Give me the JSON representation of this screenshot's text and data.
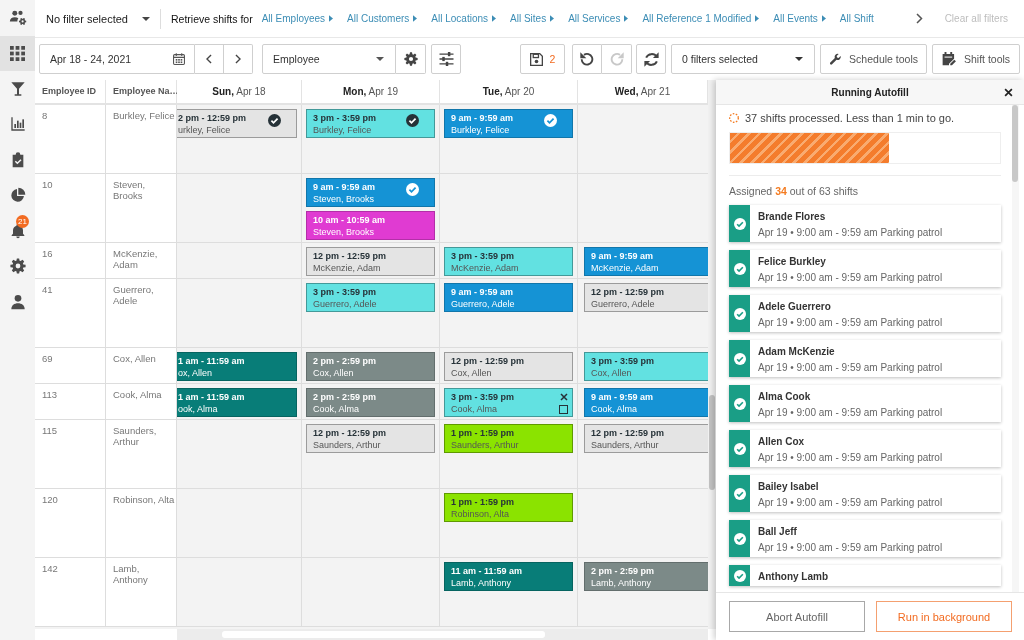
{
  "sidebar": {
    "items": [
      {
        "kind": "team",
        "selected": false
      },
      {
        "kind": "schedule",
        "selected": true
      },
      {
        "kind": "filters",
        "selected": false
      },
      {
        "kind": "reports",
        "selected": false
      },
      {
        "kind": "tasks",
        "selected": false
      },
      {
        "kind": "analytics",
        "selected": false
      },
      {
        "kind": "notifications",
        "selected": false,
        "badge": "21"
      },
      {
        "kind": "settings",
        "selected": false
      },
      {
        "kind": "profile",
        "selected": false
      }
    ]
  },
  "filter_bar": {
    "saved_filter": "No filter selected",
    "retrieve_label": "Retrieve shifts for",
    "filters": [
      {
        "label": "All Employees",
        "truncated": false
      },
      {
        "label": "All Customers",
        "truncated": false
      },
      {
        "label": "All Locations",
        "truncated": false
      },
      {
        "label": "All Sites",
        "truncated": false
      },
      {
        "label": "All Services",
        "truncated": false
      },
      {
        "label": "All Reference 1 Modified",
        "truncated": false
      },
      {
        "label": "All Events",
        "truncated": false
      },
      {
        "label": "All Shift",
        "truncated": true
      }
    ],
    "clear_all": {
      "label": "Clear all filters",
      "disabled": true
    }
  },
  "toolbar": {
    "date_range": "Apr 18 - 24, 2021",
    "group_by": "Employee",
    "unsaved_changes": "2",
    "undo": {
      "disabled": false
    },
    "redo": {
      "disabled": true
    },
    "filters_select": "0 filters selected",
    "tools": [
      {
        "kind": "schedule",
        "label": "Schedule tools"
      },
      {
        "kind": "shift",
        "label": "Shift tools"
      }
    ]
  },
  "grid": {
    "columns": [
      {
        "label": "Employee ID"
      },
      {
        "label": "Employee Na…"
      }
    ],
    "days": [
      {
        "label": "**Sun,** Apr 18"
      },
      {
        "label": "**Mon,** Apr 19"
      },
      {
        "label": "**Tue,** Apr 20"
      },
      {
        "label": "**Wed,** Apr 21"
      }
    ],
    "rows": [
      {
        "id": "8",
        "name": "Burkley, Felice",
        "expanded": true,
        "cells": [
          {
            "shifts": [
              {
                "time": "2 pm - 12:59 pm",
                "employee": "urkley, Felice",
                "color": "#e4e4e4",
                "confirmed": true,
                "hovered": false
              }
            ]
          },
          {
            "shifts": [
              {
                "time": "3 pm - 3:59 pm",
                "employee": "Burkley, Felice",
                "color": "#62e1e1",
                "confirmed": true,
                "hovered": false
              }
            ]
          },
          {
            "shifts": [
              {
                "time": "9 am - 9:59 am",
                "employee": "Burkley, Felice",
                "color": "#1593d5",
                "confirmed": true,
                "hovered": false
              }
            ]
          },
          {}
        ]
      },
      {
        "id": "10",
        "name": "Steven, Brooks",
        "expanded": true,
        "cells": [
          {},
          {
            "shifts": [
              {
                "time": "9 am - 9:59 am",
                "employee": "Steven, Brooks",
                "color": "#1593d5",
                "confirmed": true,
                "hovered": false
              },
              {
                "time": "10 am - 10:59 am",
                "employee": "Steven, Brooks",
                "color": "#e03bd2",
                "confirmed": false,
                "hovered": false
              }
            ]
          },
          {},
          {}
        ]
      },
      {
        "id": "16",
        "name": "McKenzie, Adam",
        "expanded": false,
        "cells": [
          {},
          {
            "shifts": [
              {
                "time": "12 pm - 12:59 pm",
                "employee": "McKenzie, Adam",
                "color": "#e4e4e4",
                "confirmed": false,
                "hovered": false
              }
            ]
          },
          {
            "shifts": [
              {
                "time": "3 pm - 3:59 pm",
                "employee": "McKenzie, Adam",
                "color": "#62e1e1",
                "confirmed": false,
                "hovered": false
              }
            ]
          },
          {
            "shifts": [
              {
                "time": "9 am - 9:59 am",
                "employee": "McKenzie, Adam",
                "color": "#1593d5",
                "confirmed": false,
                "hovered": false
              }
            ]
          }
        ]
      },
      {
        "id": "41",
        "name": "Guerrero, Adele",
        "expanded": true,
        "cells": [
          {},
          {
            "shifts": [
              {
                "time": "3 pm - 3:59 pm",
                "employee": "Guerrero, Adele",
                "color": "#62e1e1",
                "confirmed": false,
                "hovered": false
              }
            ]
          },
          {
            "shifts": [
              {
                "time": "9 am - 9:59 am",
                "employee": "Guerrero, Adele",
                "color": "#1593d5",
                "confirmed": false,
                "hovered": false
              }
            ]
          },
          {
            "shifts": [
              {
                "time": "12 pm - 12:59 pm",
                "employee": "Guerrero, Adele",
                "color": "#e4e4e4",
                "confirmed": false,
                "hovered": false
              }
            ]
          }
        ]
      },
      {
        "id": "69",
        "name": "Cox, Allen",
        "expanded": false,
        "cells": [
          {
            "shifts": [
              {
                "time": "1 am - 11:59 am",
                "employee": "ox, Allen",
                "color": "#087d78",
                "confirmed": false,
                "hovered": false
              }
            ]
          },
          {
            "shifts": [
              {
                "time": "2 pm - 2:59 pm",
                "employee": "Cox, Allen",
                "color": "#7c8a88",
                "confirmed": false,
                "hovered": false
              }
            ]
          },
          {
            "shifts": [
              {
                "time": "12 pm - 12:59 pm",
                "employee": "Cox, Allen",
                "color": "#e4e4e4",
                "confirmed": false,
                "hovered": false
              }
            ]
          },
          {
            "shifts": [
              {
                "time": "3 pm - 3:59 pm",
                "employee": "Cox, Allen",
                "color": "#62e1e1",
                "confirmed": false,
                "hovered": false
              }
            ]
          }
        ]
      },
      {
        "id": "113",
        "name": "Cook, Alma",
        "expanded": false,
        "cells": [
          {
            "shifts": [
              {
                "time": "1 am - 11:59 am",
                "employee": "ook, Alma",
                "color": "#087d78",
                "confirmed": false,
                "hovered": false
              }
            ]
          },
          {
            "shifts": [
              {
                "time": "2 pm - 2:59 pm",
                "employee": "Cook, Alma",
                "color": "#7c8a88",
                "confirmed": false,
                "hovered": false
              }
            ]
          },
          {
            "shifts": [
              {
                "time": "3 pm - 3:59 pm",
                "employee": "Cook, Alma",
                "color": "#62e1e1",
                "confirmed": false,
                "hovered": true
              }
            ]
          },
          {
            "shifts": [
              {
                "time": "9 am - 9:59 am",
                "employee": "Cook, Alma",
                "color": "#1593d5",
                "confirmed": false,
                "hovered": false
              }
            ]
          }
        ]
      },
      {
        "id": "115",
        "name": "Saunders, Arthur",
        "expanded": true,
        "cells": [
          {},
          {
            "shifts": [
              {
                "time": "12 pm - 12:59 pm",
                "employee": "Saunders, Arthur",
                "color": "#e4e4e4",
                "confirmed": false,
                "hovered": false
              }
            ]
          },
          {
            "shifts": [
              {
                "time": "1 pm - 1:59 pm",
                "employee": "Saunders, Arthur",
                "color": "#8be300",
                "confirmed": false,
                "hovered": false
              }
            ]
          },
          {
            "shifts": [
              {
                "time": "12 pm - 12:59 pm",
                "employee": "Saunders, Arthur",
                "color": "#e4e4e4",
                "confirmed": false,
                "hovered": false
              }
            ]
          }
        ]
      },
      {
        "id": "120",
        "name": "Robinson, Alta",
        "expanded": true,
        "cells": [
          {},
          {},
          {
            "shifts": [
              {
                "time": "1 pm - 1:59 pm",
                "employee": "Robinson, Alta",
                "color": "#8be300",
                "confirmed": false,
                "hovered": false
              }
            ]
          },
          {}
        ]
      },
      {
        "id": "142",
        "name": "Lamb, Anthony",
        "expanded": true,
        "cells": [
          {},
          {},
          {
            "shifts": [
              {
                "time": "11 am - 11:59 am",
                "employee": "Lamb, Anthony",
                "color": "#087d78",
                "confirmed": false,
                "hovered": false
              }
            ]
          },
          {
            "shifts": [
              {
                "time": "2 pm - 2:59 pm",
                "employee": "Lamb, Anthony",
                "color": "#7c8a88",
                "confirmed": false,
                "hovered": false
              }
            ]
          }
        ]
      }
    ]
  },
  "autofill": {
    "title": "Running Autofill",
    "status": "37 shifts processed. Less than 1 min to go.",
    "progress": {
      "level": 0.59
    },
    "summary": "Assigned **34** out of 63 shifts",
    "assignments": [
      {
        "name": "Brande Flores",
        "detail": "Apr 19 • 9:00 am - 9:59 am Parking patrol",
        "done": true
      },
      {
        "name": "Felice Burkley",
        "detail": "Apr 19 • 9:00 am - 9:59 am Parking patrol",
        "done": true
      },
      {
        "name": "Adele Guerrero",
        "detail": "Apr 19 • 9:00 am - 9:59 am Parking patrol",
        "done": true
      },
      {
        "name": "Adam McKenzie",
        "detail": "Apr 19 • 9:00 am - 9:59 am Parking patrol",
        "done": true
      },
      {
        "name": "Alma Cook",
        "detail": "Apr 19 • 9:00 am - 9:59 am Parking patrol",
        "done": true
      },
      {
        "name": "Allen Cox",
        "detail": "Apr 19 • 9:00 am - 9:59 am Parking patrol",
        "done": true
      },
      {
        "name": "Bailey Isabel",
        "detail": "Apr 19 • 9:00 am - 9:59 am Parking patrol",
        "done": true
      },
      {
        "name": "Ball Jeff",
        "detail": "Apr 19 • 9:00 am - 9:59 am Parking patrol",
        "done": true
      },
      {
        "name": "Anthony Lamb",
        "done": true
      }
    ],
    "buttons": [
      {
        "kind": "abort",
        "label": "Abort Autofill"
      },
      {
        "kind": "background",
        "label": "Run in background"
      }
    ]
  }
}
